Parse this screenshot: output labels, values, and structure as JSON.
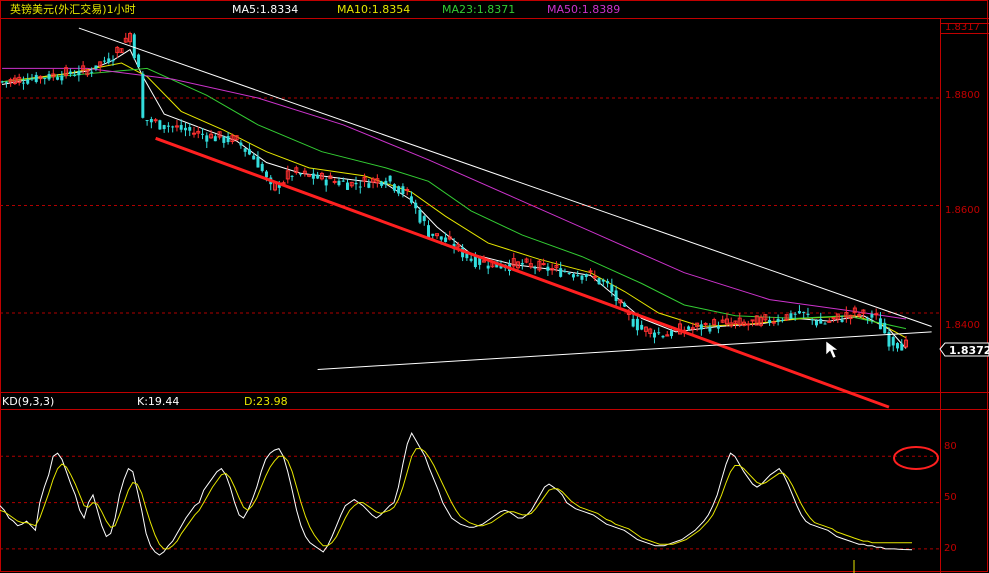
{
  "header": {
    "symbol_title": "英镑美元(外汇交易)1小时",
    "ma5_label": "MA5:1.8334",
    "ma10_label": "MA10:1.8354",
    "ma23_label": "MA23:1.8371",
    "ma50_label": "MA50:1.8389"
  },
  "kd_header": {
    "indicator_label": "KD(9,3,3)",
    "k_label": "K:19.44",
    "d_label": "D:23.98"
  },
  "price_axis": {
    "ticks": [
      "1.8317",
      "1.8800",
      "1.8600",
      "1.8400"
    ],
    "current_price_label": "1.8372"
  },
  "kd_axis": {
    "ticks": [
      "80",
      "50",
      "20"
    ]
  },
  "colors": {
    "background": "#000000",
    "frame": "#c00000",
    "grid": "#b00000",
    "up_candle": "#ff3030",
    "down_candle": "#33dddd",
    "ma5": "#ffffff",
    "ma10": "#e6e600",
    "ma23": "#33cc33",
    "ma50": "#cc33cc",
    "trendline_red": "#ff2020",
    "trendline_white": "#ffffff",
    "k_line": "#ffffff",
    "d_line": "#e6e600"
  },
  "chart_data": [
    {
      "type": "candlestick",
      "title": "英镑美元(外汇交易)1小时",
      "series_labels": [
        "MA5:1.8334",
        "MA10:1.8354",
        "MA23:1.8371",
        "MA50:1.8389"
      ],
      "ylim": [
        1.8255,
        1.8945
      ],
      "grid": true,
      "close_path": [
        [
          0,
          1.883
        ],
        [
          10,
          1.884
        ],
        [
          20,
          1.885
        ],
        [
          26,
          1.888
        ],
        [
          30,
          1.892
        ],
        [
          32,
          1.885
        ],
        [
          33,
          1.876
        ],
        [
          38,
          1.875
        ],
        [
          48,
          1.873
        ],
        [
          55,
          1.872
        ],
        [
          60,
          1.868
        ],
        [
          63,
          1.863
        ],
        [
          68,
          1.866
        ],
        [
          75,
          1.865
        ],
        [
          82,
          1.864
        ],
        [
          90,
          1.865
        ],
        [
          95,
          1.862
        ],
        [
          100,
          1.855
        ],
        [
          105,
          1.853
        ],
        [
          110,
          1.85
        ],
        [
          115,
          1.849
        ],
        [
          122,
          1.849
        ],
        [
          130,
          1.848
        ],
        [
          138,
          1.847
        ],
        [
          142,
          1.845
        ],
        [
          146,
          1.84
        ],
        [
          150,
          1.837
        ],
        [
          155,
          1.836
        ],
        [
          160,
          1.837
        ],
        [
          168,
          1.838
        ],
        [
          175,
          1.838
        ],
        [
          182,
          1.839
        ],
        [
          187,
          1.84
        ],
        [
          192,
          1.838
        ],
        [
          196,
          1.839
        ],
        [
          200,
          1.84
        ],
        [
          205,
          1.839
        ],
        [
          208,
          1.835
        ],
        [
          212,
          1.834
        ]
      ],
      "moving_averages": [
        {
          "name": "MA5",
          "path": [
            [
              0,
              1.8825
            ],
            [
              10,
              1.884
            ],
            [
              20,
              1.885
            ],
            [
              26,
              1.887
            ],
            [
              30,
              1.889
            ],
            [
              33,
              1.884
            ],
            [
              38,
              1.877
            ],
            [
              48,
              1.874
            ],
            [
              55,
              1.872
            ],
            [
              62,
              1.868
            ],
            [
              70,
              1.866
            ],
            [
              80,
              1.865
            ],
            [
              90,
              1.864
            ],
            [
              96,
              1.861
            ],
            [
              102,
              1.856
            ],
            [
              110,
              1.851
            ],
            [
              120,
              1.849
            ],
            [
              130,
              1.848
            ],
            [
              138,
              1.847
            ],
            [
              144,
              1.843
            ],
            [
              150,
              1.839
            ],
            [
              158,
              1.8365
            ],
            [
              168,
              1.8375
            ],
            [
              178,
              1.838
            ],
            [
              186,
              1.839
            ],
            [
              194,
              1.8385
            ],
            [
              202,
              1.8395
            ],
            [
              208,
              1.837
            ],
            [
              212,
              1.8334
            ]
          ]
        },
        {
          "name": "MA10",
          "path": [
            [
              0,
              1.883
            ],
            [
              15,
              1.8845
            ],
            [
              28,
              1.8865
            ],
            [
              34,
              1.884
            ],
            [
              42,
              1.8775
            ],
            [
              52,
              1.874
            ],
            [
              62,
              1.87
            ],
            [
              72,
              1.867
            ],
            [
              85,
              1.8655
            ],
            [
              96,
              1.8625
            ],
            [
              104,
              1.858
            ],
            [
              114,
              1.853
            ],
            [
              126,
              1.85
            ],
            [
              138,
              1.8475
            ],
            [
              146,
              1.844
            ],
            [
              154,
              1.84
            ],
            [
              164,
              1.8375
            ],
            [
              176,
              1.838
            ],
            [
              188,
              1.839
            ],
            [
              200,
              1.8395
            ],
            [
              206,
              1.838
            ],
            [
              212,
              1.8354
            ]
          ]
        },
        {
          "name": "MA23",
          "path": [
            [
              0,
              1.883
            ],
            [
              20,
              1.8845
            ],
            [
              34,
              1.8855
            ],
            [
              48,
              1.8805
            ],
            [
              60,
              1.875
            ],
            [
              75,
              1.87
            ],
            [
              90,
              1.867
            ],
            [
              100,
              1.8645
            ],
            [
              110,
              1.859
            ],
            [
              122,
              1.8545
            ],
            [
              136,
              1.8505
            ],
            [
              150,
              1.8455
            ],
            [
              160,
              1.8415
            ],
            [
              172,
              1.8395
            ],
            [
              186,
              1.839
            ],
            [
              198,
              1.8395
            ],
            [
              212,
              1.8371
            ]
          ]
        },
        {
          "name": "MA50",
          "path": [
            [
              0,
              1.8855
            ],
            [
              20,
              1.8855
            ],
            [
              40,
              1.8835
            ],
            [
              60,
              1.88
            ],
            [
              80,
              1.875
            ],
            [
              100,
              1.8685
            ],
            [
              120,
              1.8615
            ],
            [
              140,
              1.8545
            ],
            [
              160,
              1.8475
            ],
            [
              180,
              1.8425
            ],
            [
              198,
              1.8405
            ],
            [
              212,
              1.8389
            ]
          ]
        }
      ],
      "trendlines": [
        {
          "name": "upper-resistance",
          "color": "white",
          "points": [
            [
              18,
              1.893
            ],
            [
              218,
              1.8375
            ]
          ]
        },
        {
          "name": "lower-channel",
          "color": "red",
          "points": [
            [
              36,
              1.8725
            ],
            [
              208,
              1.8225
            ]
          ]
        },
        {
          "name": "base-support",
          "color": "white",
          "points": [
            [
              74,
              1.8295
            ],
            [
              218,
              1.8365
            ]
          ]
        }
      ],
      "current_price": 1.8372
    },
    {
      "type": "line",
      "title": "KD(9,3,3)",
      "series_labels": [
        "K:19.44",
        "D:23.98"
      ],
      "ylim": [
        5,
        110
      ],
      "ticks": [
        80,
        50,
        20
      ],
      "grid": true,
      "series": [
        {
          "name": "K",
          "values": [
            48,
            45,
            40,
            38,
            35,
            36,
            38,
            35,
            32,
            50,
            60,
            68,
            80,
            82,
            78,
            70,
            62,
            55,
            45,
            40,
            50,
            55,
            45,
            35,
            28,
            30,
            40,
            55,
            65,
            72,
            70,
            58,
            45,
            30,
            22,
            18,
            16,
            18,
            22,
            25,
            30,
            35,
            40,
            44,
            48,
            50,
            58,
            62,
            66,
            70,
            72,
            68,
            60,
            50,
            42,
            40,
            45,
            52,
            60,
            70,
            78,
            82,
            84,
            85,
            80,
            70,
            58,
            45,
            35,
            28,
            24,
            22,
            20,
            18,
            22,
            28,
            35,
            42,
            48,
            50,
            52,
            50,
            48,
            45,
            42,
            40,
            42,
            45,
            48,
            50,
            60,
            75,
            88,
            95,
            90,
            85,
            80,
            72,
            65,
            58,
            50,
            45,
            40,
            38,
            36,
            35,
            34,
            34,
            35,
            36,
            38,
            40,
            42,
            44,
            45,
            44,
            42,
            40,
            40,
            42,
            45,
            50,
            55,
            60,
            62,
            60,
            58,
            55,
            50,
            48,
            46,
            45,
            44,
            43,
            42,
            40,
            38,
            36,
            35,
            34,
            33,
            32,
            30,
            28,
            26,
            25,
            24,
            23,
            22,
            22,
            22,
            23,
            24,
            25,
            26,
            28,
            30,
            32,
            35,
            38,
            42,
            48,
            55,
            65,
            75,
            82,
            80,
            75,
            70,
            66,
            62,
            60,
            62,
            65,
            68,
            70,
            72,
            68,
            62,
            55,
            48,
            42,
            38,
            36,
            35,
            34,
            33,
            32,
            30,
            28,
            27,
            26,
            25,
            24,
            23,
            23,
            22,
            22,
            21,
            21,
            20,
            20,
            20,
            19.8,
            19.6,
            19.5,
            19.44
          ]
        },
        {
          "name": "D",
          "values": [
            45,
            44,
            42,
            40,
            38,
            37,
            37,
            36,
            35,
            40,
            48,
            56,
            65,
            72,
            75,
            73,
            68,
            62,
            55,
            48,
            47,
            50,
            49,
            44,
            38,
            34,
            35,
            42,
            50,
            58,
            63,
            62,
            56,
            46,
            37,
            29,
            23,
            20,
            20,
            22,
            25,
            30,
            34,
            38,
            42,
            45,
            50,
            55,
            60,
            64,
            68,
            69,
            66,
            60,
            53,
            47,
            45,
            48,
            53,
            60,
            67,
            73,
            77,
            80,
            80,
            77,
            70,
            60,
            50,
            41,
            34,
            29,
            25,
            22,
            22,
            24,
            28,
            34,
            40,
            45,
            48,
            50,
            50,
            48,
            46,
            44,
            43,
            44,
            45,
            47,
            52,
            60,
            70,
            80,
            85,
            85,
            83,
            79,
            74,
            68,
            62,
            56,
            50,
            45,
            41,
            39,
            37,
            36,
            35,
            35,
            36,
            37,
            39,
            41,
            43,
            44,
            44,
            43,
            42,
            42,
            43,
            46,
            50,
            54,
            58,
            59,
            59,
            57,
            54,
            51,
            49,
            47,
            46,
            45,
            44,
            43,
            41,
            39,
            38,
            36,
            35,
            34,
            33,
            31,
            29,
            27,
            26,
            25,
            24,
            23,
            23,
            23,
            23,
            24,
            25,
            26,
            28,
            30,
            32,
            35,
            38,
            42,
            48,
            55,
            63,
            70,
            74,
            74,
            72,
            69,
            66,
            63,
            62,
            63,
            65,
            67,
            69,
            69,
            66,
            61,
            55,
            49,
            44,
            40,
            37,
            36,
            35,
            34,
            33,
            31,
            30,
            29,
            28,
            27,
            26,
            25,
            25,
            24,
            24,
            24,
            24,
            24,
            24,
            24,
            24,
            24,
            23.98
          ]
        }
      ]
    }
  ]
}
